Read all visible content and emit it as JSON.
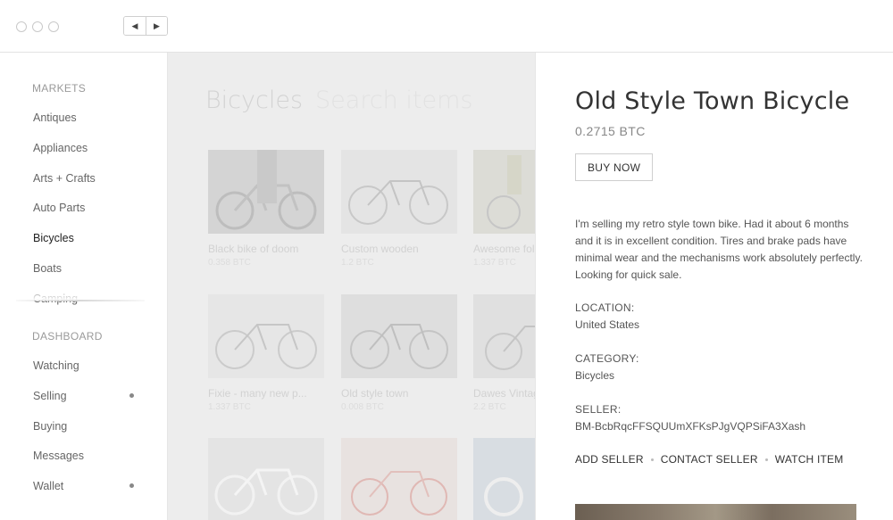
{
  "nav": {
    "back_glyph": "◀",
    "forward_glyph": "▶"
  },
  "sidebar": {
    "markets_title": "MARKETS",
    "markets": [
      "Antiques",
      "Appliances",
      "Arts + Crafts",
      "Auto Parts",
      "Bicycles",
      "Boats",
      "Camping"
    ],
    "active": "Bicycles",
    "dashboard_title": "DASHBOARD",
    "dashboard": [
      {
        "label": "Watching",
        "dot": false
      },
      {
        "label": "Selling",
        "dot": true
      },
      {
        "label": "Buying",
        "dot": false
      },
      {
        "label": "Messages",
        "dot": false
      },
      {
        "label": "Wallet",
        "dot": true
      }
    ]
  },
  "main": {
    "heading": "Bicycles",
    "search_placeholder": "Search items",
    "items": [
      {
        "title": "Black bike of doom",
        "price": "0.358 BTC"
      },
      {
        "title": "Custom wooden",
        "price": "1.2 BTC"
      },
      {
        "title": "Awesome fold",
        "price": "1.337 BTC"
      },
      {
        "title": "Fixie - many new p...",
        "price": "1.337 BTC"
      },
      {
        "title": "Old style town",
        "price": "0.008 BTC"
      },
      {
        "title": "Dawes Vintage",
        "price": "2.2 BTC"
      }
    ]
  },
  "detail": {
    "title": "Old Style Town Bicycle",
    "price": "0.2715 BTC",
    "buy_label": "BUY NOW",
    "description": "I'm selling my retro style town bike. Had it about 6 months and it is in excellent condition. Tires and brake pads have minimal wear and the mechanisms work absolutely perfectly. Looking for quick sale.",
    "location_label": "LOCATION:",
    "location": "United States",
    "category_label": "CATEGORY:",
    "category": "Bicycles",
    "seller_label": "SELLER:",
    "seller": "BM-BcbRqcFFSQUUmXFKsPJgVQPSiFA3Xash",
    "actions": [
      "ADD SELLER",
      "CONTACT SELLER",
      "WATCH ITEM"
    ]
  }
}
